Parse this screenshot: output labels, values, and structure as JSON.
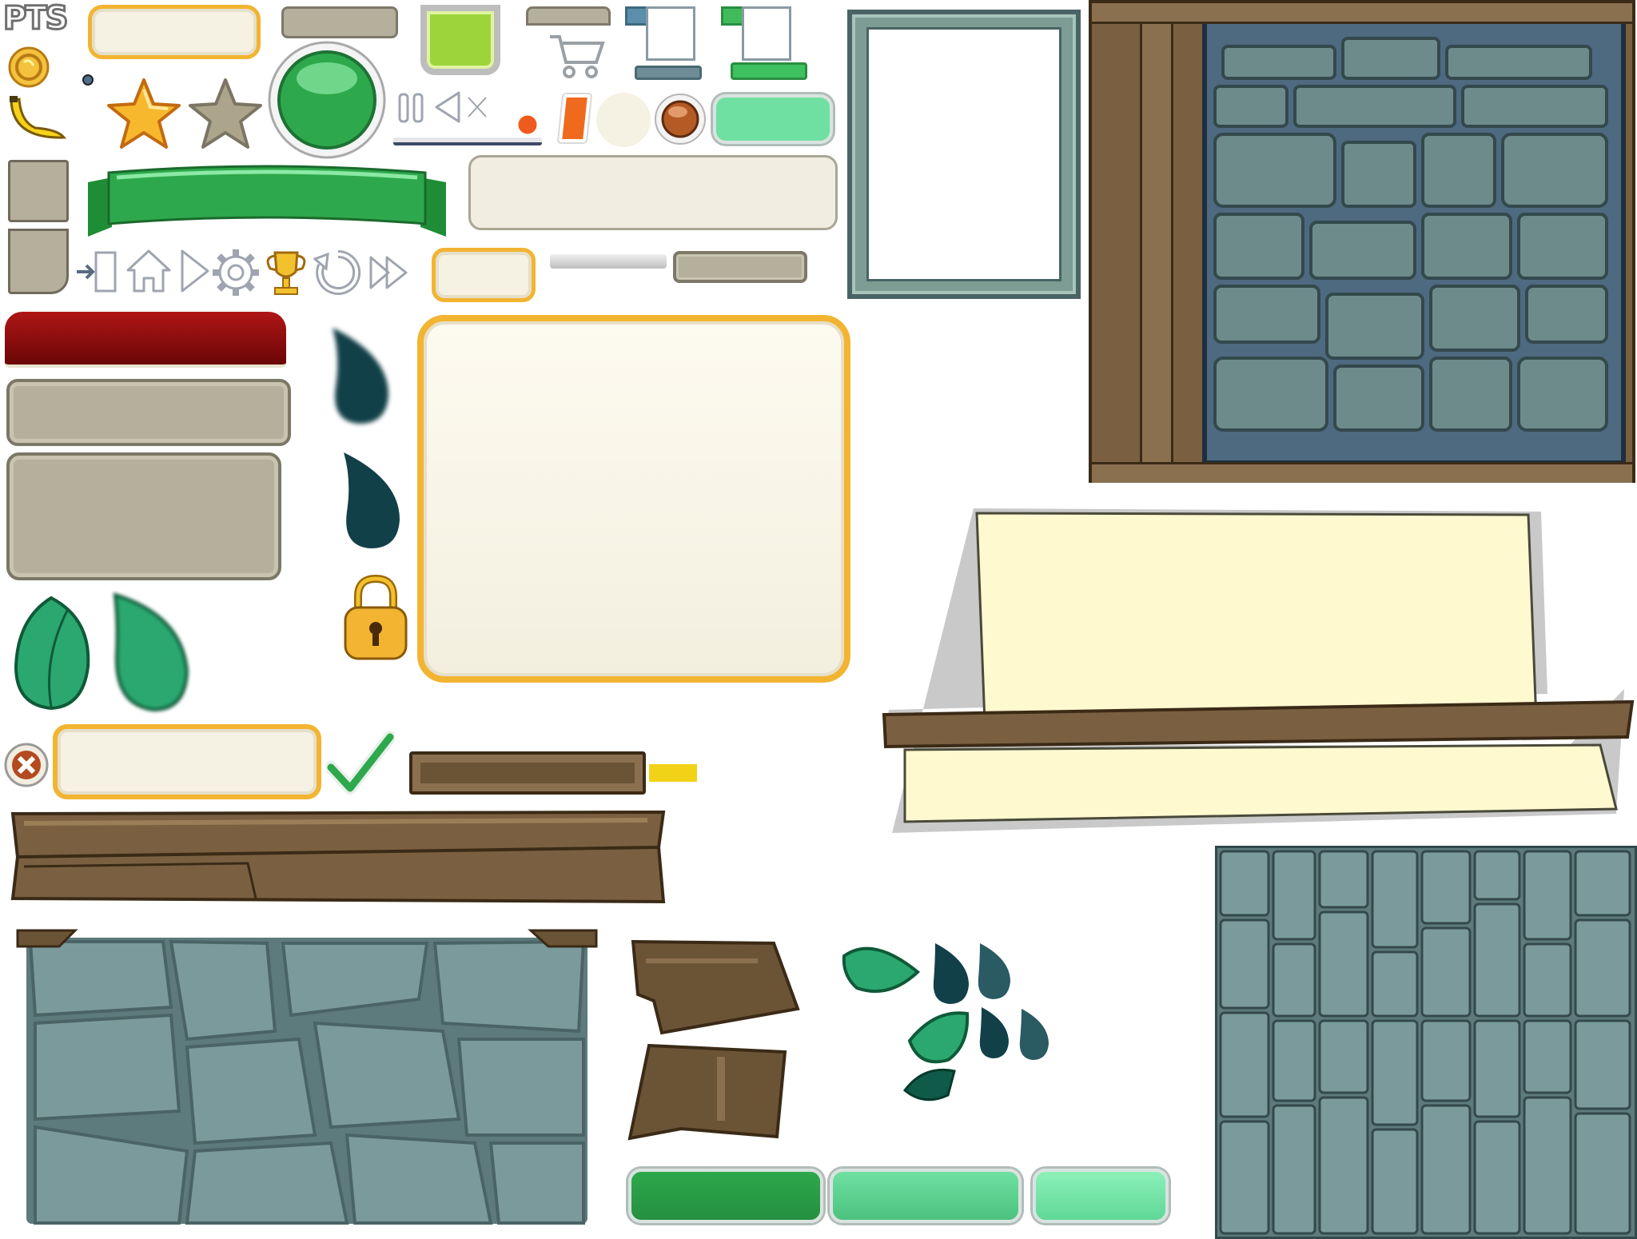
{
  "logo_text": "PTS",
  "icon_names": [
    "coin-icon",
    "banana-icon",
    "star-icon",
    "star-empty-icon",
    "pause-icon",
    "play-icon",
    "mute-icon",
    "cart-icon",
    "exit-door-icon",
    "home-icon",
    "next-arrow-icon",
    "settings-gear-icon",
    "trophy-icon",
    "restart-icon",
    "fast-forward-icon",
    "lock-icon",
    "close-x-icon",
    "checkmark-icon",
    "leaf-icon",
    "water-drop-icon"
  ],
  "colors": {
    "green": "#2ea84c",
    "light_green": "#6fe0a2",
    "gold": "#f2b431",
    "red": "#8b0b0b",
    "stone_gray": "#b5b09c",
    "stone_blue": "#6e8b8c",
    "wood": "#6b5436",
    "parchment": "#fff9d0",
    "teal_drop": "#124048"
  }
}
